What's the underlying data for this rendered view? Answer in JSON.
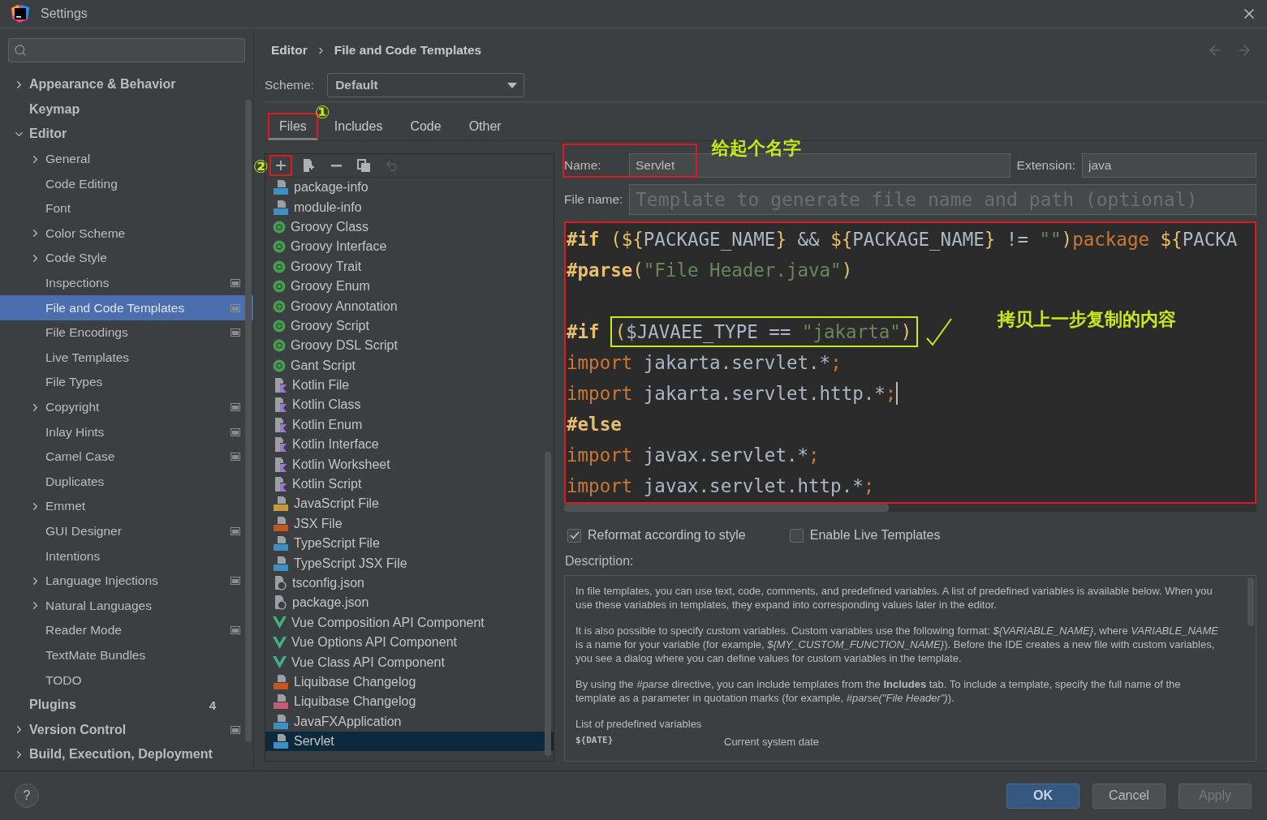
{
  "window": {
    "title": "Settings"
  },
  "sidebar": {
    "items": [
      {
        "label": "Appearance & Behavior",
        "expanded": false,
        "selected": false
      },
      {
        "label": "Keymap",
        "selected": false
      },
      {
        "label": "Editor",
        "expanded": true,
        "selected": false,
        "children": [
          {
            "label": "General",
            "expanded": false,
            "selected": false
          },
          {
            "label": "Code Editing",
            "selected": false
          },
          {
            "label": "Font",
            "selected": false
          },
          {
            "label": "Color Scheme",
            "expanded": false,
            "selected": false
          },
          {
            "label": "Code Style",
            "expanded": false,
            "selected": false
          },
          {
            "label": "Inspections",
            "project_icon": true,
            "selected": false
          },
          {
            "label": "File and Code Templates",
            "project_icon": true,
            "selected": true
          },
          {
            "label": "File Encodings",
            "project_icon": true,
            "selected": false
          },
          {
            "label": "Live Templates",
            "selected": false
          },
          {
            "label": "File Types",
            "selected": false
          },
          {
            "label": "Copyright",
            "expanded": false,
            "project_icon": true,
            "selected": false
          },
          {
            "label": "Inlay Hints",
            "project_icon": true,
            "selected": false
          },
          {
            "label": "Camel Case",
            "project_icon": true,
            "selected": false
          },
          {
            "label": "Duplicates",
            "selected": false
          },
          {
            "label": "Emmet",
            "expanded": false,
            "selected": false
          },
          {
            "label": "GUI Designer",
            "project_icon": true,
            "selected": false
          },
          {
            "label": "Intentions",
            "selected": false
          },
          {
            "label": "Language Injections",
            "expanded": false,
            "project_icon": true,
            "selected": false
          },
          {
            "label": "Natural Languages",
            "expanded": false,
            "selected": false
          },
          {
            "label": "Reader Mode",
            "project_icon": true,
            "selected": false
          },
          {
            "label": "TextMate Bundles",
            "selected": false
          },
          {
            "label": "TODO",
            "selected": false
          }
        ]
      },
      {
        "label": "Plugins",
        "badge": "4",
        "selected": false
      },
      {
        "label": "Version Control",
        "expanded": false,
        "project_icon": true,
        "selected": false
      },
      {
        "label": "Build, Execution, Deployment",
        "expanded": false,
        "selected": false
      }
    ]
  },
  "breadcrumb": [
    "Editor",
    "File and Code Templates"
  ],
  "scheme": {
    "label": "Scheme:",
    "value": "Default"
  },
  "tabs": [
    {
      "label": "Files",
      "selected": true,
      "highlighted": true
    },
    {
      "label": "Includes",
      "selected": false,
      "highlighted": false
    },
    {
      "label": "Code",
      "selected": false,
      "highlighted": false
    },
    {
      "label": "Other",
      "selected": false,
      "highlighted": false
    }
  ],
  "toolbar": [
    {
      "kind": "add",
      "highlighted": true,
      "disabled": false
    },
    {
      "kind": "add-file",
      "highlighted": false,
      "disabled": false
    },
    {
      "kind": "remove",
      "highlighted": false,
      "disabled": false
    },
    {
      "kind": "copy",
      "highlighted": false,
      "disabled": false
    },
    {
      "kind": "undo",
      "highlighted": false,
      "disabled": true
    }
  ],
  "templates": [
    {
      "label": "package-info",
      "kind": "java",
      "selected": false
    },
    {
      "label": "module-info",
      "kind": "java",
      "selected": false
    },
    {
      "label": "Groovy Class",
      "kind": "groovy",
      "selected": false
    },
    {
      "label": "Groovy Interface",
      "kind": "groovy",
      "selected": false
    },
    {
      "label": "Groovy Trait",
      "kind": "groovy",
      "selected": false
    },
    {
      "label": "Groovy Enum",
      "kind": "groovy",
      "selected": false
    },
    {
      "label": "Groovy Annotation",
      "kind": "groovy",
      "selected": false
    },
    {
      "label": "Groovy Script",
      "kind": "groovy",
      "selected": false
    },
    {
      "label": "Groovy DSL Script",
      "kind": "groovy",
      "selected": false
    },
    {
      "label": "Gant Script",
      "kind": "groovy",
      "selected": false
    },
    {
      "label": "Kotlin File",
      "kind": "kotlin",
      "selected": false
    },
    {
      "label": "Kotlin Class",
      "kind": "kotlin",
      "selected": false
    },
    {
      "label": "Kotlin Enum",
      "kind": "kotlin",
      "selected": false
    },
    {
      "label": "Kotlin Interface",
      "kind": "kotlin",
      "selected": false
    },
    {
      "label": "Kotlin Worksheet",
      "kind": "kotlin",
      "selected": false
    },
    {
      "label": "Kotlin Script",
      "kind": "kotlin",
      "selected": false
    },
    {
      "label": "JavaScript File",
      "kind": "js",
      "selected": false
    },
    {
      "label": "JSX File",
      "kind": "jsx",
      "selected": false
    },
    {
      "label": "TypeScript File",
      "kind": "ts",
      "selected": false
    },
    {
      "label": "TypeScript JSX File",
      "kind": "tsx",
      "selected": false
    },
    {
      "label": "tsconfig.json",
      "kind": "json",
      "selected": false
    },
    {
      "label": "package.json",
      "kind": "json",
      "selected": false
    },
    {
      "label": "Vue Composition API Component",
      "kind": "vue",
      "selected": false
    },
    {
      "label": "Vue Options API Component",
      "kind": "vue",
      "selected": false
    },
    {
      "label": "Vue Class API Component",
      "kind": "vue",
      "selected": false
    },
    {
      "label": "Liquibase Changelog",
      "kind": "xml",
      "selected": false
    },
    {
      "label": "Liquibase Changelog",
      "kind": "yml",
      "selected": false
    },
    {
      "label": "JavaFXApplication",
      "kind": "java",
      "selected": false
    },
    {
      "label": "Servlet",
      "kind": "java",
      "selected": true
    }
  ],
  "form": {
    "name": {
      "label": "Name:",
      "value": "Servlet",
      "highlighted": true
    },
    "extension": {
      "label": "Extension:",
      "value": "java"
    },
    "file_name": {
      "label": "File name:",
      "placeholder": "Template to generate file name and path (optional)"
    }
  },
  "editor": {
    "highlighted": true,
    "lines": [
      {
        "cursor": false,
        "tokens": [
          {
            "text": "#if",
            "kind": "directive"
          },
          {
            "text": " (${",
            "kind": "brace"
          },
          {
            "text": "PACKAGE_NAME",
            "kind": "plain"
          },
          {
            "text": "}",
            "kind": "brace"
          },
          {
            "text": " && ",
            "kind": "plain"
          },
          {
            "text": "${",
            "kind": "brace"
          },
          {
            "text": "PACKAGE_NAME",
            "kind": "plain"
          },
          {
            "text": "}",
            "kind": "brace"
          },
          {
            "text": " != ",
            "kind": "plain"
          },
          {
            "text": "\"\"",
            "kind": "string"
          },
          {
            "text": ")",
            "kind": "brace"
          },
          {
            "text": "package",
            "kind": "keyword"
          },
          {
            "text": " ${",
            "kind": "brace"
          },
          {
            "text": "PACKA",
            "kind": "plain"
          }
        ]
      },
      {
        "cursor": false,
        "tokens": [
          {
            "text": "#parse",
            "kind": "directive"
          },
          {
            "text": "(",
            "kind": "brace"
          },
          {
            "text": "\"File Header.java\"",
            "kind": "string"
          },
          {
            "text": ")",
            "kind": "brace"
          }
        ]
      },
      {
        "cursor": false
      },
      {
        "cursor": false,
        "tokens": [
          {
            "text": "#if",
            "kind": "directive"
          }
        ],
        "boxed_tokens": [
          {
            "text": "(",
            "kind": "brace"
          },
          {
            "text": "$JAVAEE_TYPE == ",
            "kind": "plain"
          },
          {
            "text": "\"jakarta\"",
            "kind": "string"
          },
          {
            "text": ")",
            "kind": "brace"
          }
        ]
      },
      {
        "cursor": false,
        "tokens": [
          {
            "text": "import",
            "kind": "keyword"
          },
          {
            "text": " jakarta.servlet.*",
            "kind": "plain"
          },
          {
            "text": ";",
            "kind": "keyword"
          }
        ]
      },
      {
        "cursor": true,
        "tokens": [
          {
            "text": "import",
            "kind": "keyword"
          },
          {
            "text": " jakarta.servlet.http.*",
            "kind": "plain"
          },
          {
            "text": ";",
            "kind": "keyword"
          }
        ]
      },
      {
        "cursor": false,
        "tokens": [
          {
            "text": "#else",
            "kind": "directive"
          }
        ]
      },
      {
        "cursor": false,
        "tokens": [
          {
            "text": "import",
            "kind": "keyword"
          },
          {
            "text": " javax.servlet.*",
            "kind": "plain"
          },
          {
            "text": ";",
            "kind": "keyword"
          }
        ]
      },
      {
        "cursor": false,
        "tokens": [
          {
            "text": "import",
            "kind": "keyword"
          },
          {
            "text": " javax.servlet.http.*",
            "kind": "plain"
          },
          {
            "text": ";",
            "kind": "keyword"
          }
        ]
      }
    ]
  },
  "options": [
    {
      "label": "Reformat according to style",
      "checked": true
    },
    {
      "label": "Enable Live Templates",
      "checked": false
    }
  ],
  "description": {
    "label": "Description:",
    "paragraphs": [
      "In file templates, you can use text, code, comments, and predefined variables. A list of predefined variables is available below. When you use these variables in templates, they expand into corresponding values later in the editor.",
      "It is also possible to specify custom variables. Custom variables use the following format: *${VARIABLE_NAME}*, where *VARIABLE_NAME* is a name for your variable (for example, *${MY_CUSTOM_FUNCTION_NAME}*). Before the IDE creates a new file with custom variables, you see a dialog where you can define values for custom variables in the template.",
      "By using the *#parse* directive, you can include templates from the **Includes** tab. To include a template, specify the full name of the template as a parameter in quotation marks (for example, *#parse(\"File Header\")*).",
      "List of predefined variables"
    ],
    "variables": [
      {
        "name": "${DATE}",
        "description": "Current system date"
      }
    ]
  },
  "annotations": {
    "tabs_number": "①",
    "toolbar_number": "②",
    "name_note": "给起个名字",
    "editor_note": "拷贝上一步复制的内容"
  },
  "footer": {
    "help": "?",
    "buttons": [
      {
        "label": "OK",
        "primary": true,
        "disabled": false
      },
      {
        "label": "Cancel",
        "primary": false,
        "disabled": false
      },
      {
        "label": "Apply",
        "primary": false,
        "disabled": true
      }
    ]
  }
}
